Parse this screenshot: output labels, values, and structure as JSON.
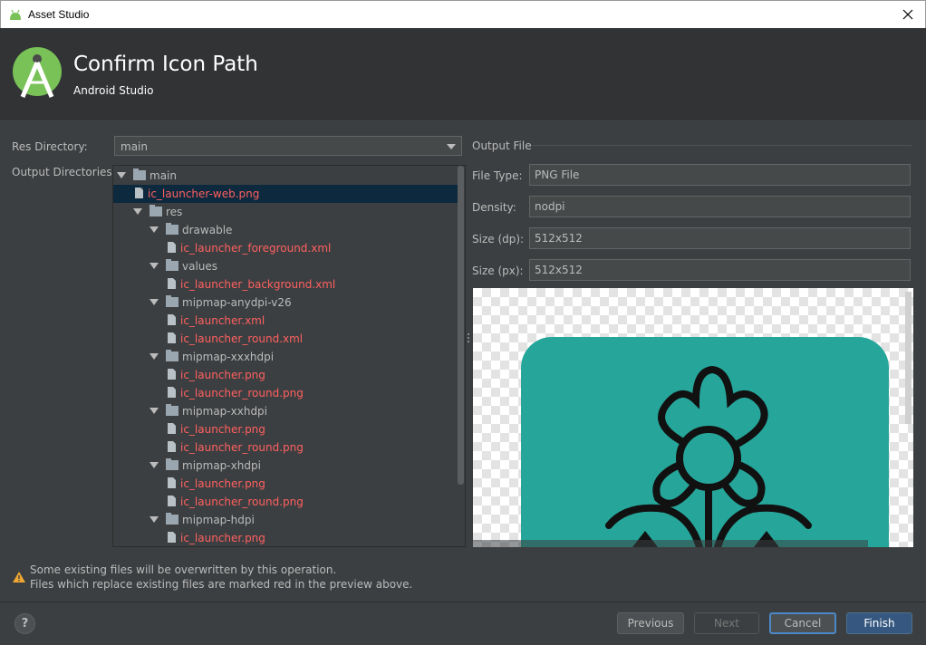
{
  "window": {
    "title": "Asset Studio"
  },
  "header": {
    "title": "Confirm Icon Path",
    "subtitle": "Android Studio"
  },
  "form": {
    "res_directory_label": "Res Directory:",
    "res_directory_value": "main",
    "output_directories_label": "Output Directories:"
  },
  "tree": [
    {
      "label": "main",
      "type": "folder",
      "level": 0,
      "expanded": true,
      "red": false
    },
    {
      "label": "ic_launcher-web.png",
      "type": "file",
      "level": 1,
      "red": true,
      "selected": true
    },
    {
      "label": "res",
      "type": "folder",
      "level": 1,
      "expanded": true,
      "red": false
    },
    {
      "label": "drawable",
      "type": "folder",
      "level": 2,
      "expanded": true,
      "red": false
    },
    {
      "label": "ic_launcher_foreground.xml",
      "type": "file",
      "level": 3,
      "red": true
    },
    {
      "label": "values",
      "type": "folder",
      "level": 2,
      "expanded": true,
      "red": false
    },
    {
      "label": "ic_launcher_background.xml",
      "type": "file",
      "level": 3,
      "red": true
    },
    {
      "label": "mipmap-anydpi-v26",
      "type": "folder",
      "level": 2,
      "expanded": true,
      "red": false
    },
    {
      "label": "ic_launcher.xml",
      "type": "file",
      "level": 3,
      "red": true
    },
    {
      "label": "ic_launcher_round.xml",
      "type": "file",
      "level": 3,
      "red": true
    },
    {
      "label": "mipmap-xxxhdpi",
      "type": "folder",
      "level": 2,
      "expanded": true,
      "red": false
    },
    {
      "label": "ic_launcher.png",
      "type": "file",
      "level": 3,
      "red": true
    },
    {
      "label": "ic_launcher_round.png",
      "type": "file",
      "level": 3,
      "red": true
    },
    {
      "label": "mipmap-xxhdpi",
      "type": "folder",
      "level": 2,
      "expanded": true,
      "red": false
    },
    {
      "label": "ic_launcher.png",
      "type": "file",
      "level": 3,
      "red": true
    },
    {
      "label": "ic_launcher_round.png",
      "type": "file",
      "level": 3,
      "red": true
    },
    {
      "label": "mipmap-xhdpi",
      "type": "folder",
      "level": 2,
      "expanded": true,
      "red": false
    },
    {
      "label": "ic_launcher.png",
      "type": "file",
      "level": 3,
      "red": true
    },
    {
      "label": "ic_launcher_round.png",
      "type": "file",
      "level": 3,
      "red": true
    },
    {
      "label": "mipmap-hdpi",
      "type": "folder",
      "level": 2,
      "expanded": true,
      "red": false
    },
    {
      "label": "ic_launcher.png",
      "type": "file",
      "level": 3,
      "red": true
    }
  ],
  "output_file": {
    "section_title": "Output File",
    "file_type_label": "File Type:",
    "file_type_value": "PNG File",
    "density_label": "Density:",
    "density_value": "nodpi",
    "size_dp_label": "Size (dp):",
    "size_dp_value": "512x512",
    "size_px_label": "Size (px):",
    "size_px_value": "512x512"
  },
  "warning": {
    "line1": "Some existing files will be overwritten by this operation.",
    "line2": "Files which replace existing files are marked red in the preview above."
  },
  "buttons": {
    "help": "?",
    "previous": "Previous",
    "next": "Next",
    "cancel": "Cancel",
    "finish": "Finish"
  },
  "colors": {
    "accent": "#365880",
    "warning_red": "#ff6060",
    "preview_tile": "#26a69a"
  }
}
